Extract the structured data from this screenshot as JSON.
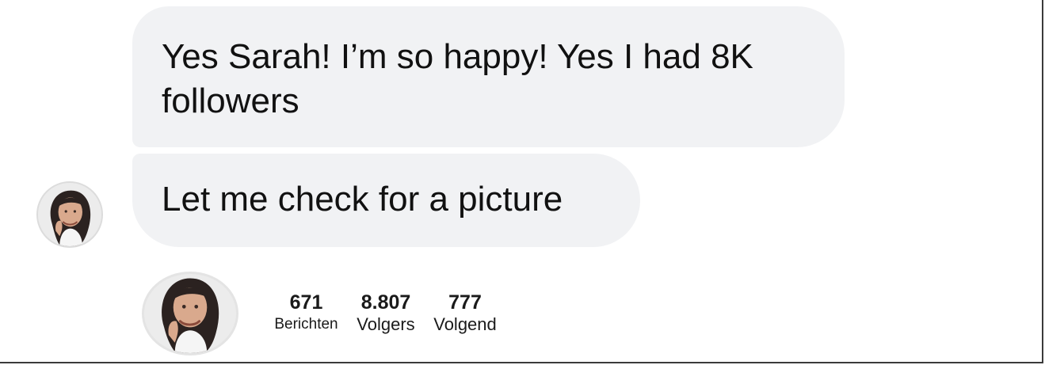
{
  "messages": [
    {
      "text": "Yes Sarah! I’m so happy! Yes I had 8K followers"
    },
    {
      "text": "Let me check for a picture"
    }
  ],
  "sender": {
    "avatar_icon": "profile-photo-woman"
  },
  "profile_stats": [
    {
      "value": "671",
      "label": "Berichten"
    },
    {
      "value": "8.807",
      "label": "Volgers"
    },
    {
      "value": "777",
      "label": "Volgend"
    }
  ],
  "colors": {
    "bubble_background": "#f1f2f4",
    "text": "#111111",
    "page_background": "#ffffff"
  }
}
